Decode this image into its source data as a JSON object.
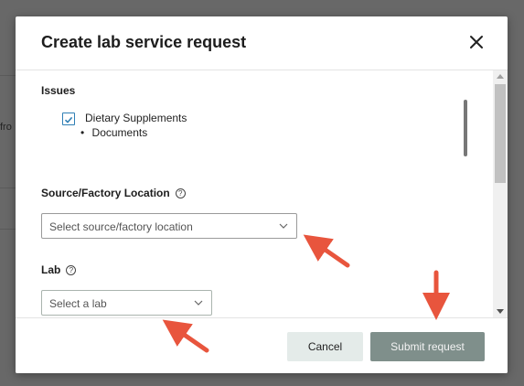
{
  "background": {
    "fragment_text": "fro"
  },
  "modal": {
    "title": "Create lab service request",
    "close_icon": "close-icon"
  },
  "issues": {
    "label": "Issues",
    "items": [
      {
        "label": "Dietary Supplements",
        "checked": true
      },
      {
        "label": "Documents",
        "bullet": true
      }
    ]
  },
  "source": {
    "label": "Source/Factory Location",
    "help_icon": "help-circle-icon",
    "placeholder": "Select source/factory location"
  },
  "lab": {
    "label": "Lab",
    "help_icon": "help-circle-icon",
    "placeholder": "Select a lab"
  },
  "footer": {
    "cancel_label": "Cancel",
    "submit_label": "Submit request"
  },
  "colors": {
    "accent": "#2f7fb5",
    "annotation_arrow": "#e8553d",
    "submit_button": "#7f8f8b",
    "cancel_button": "#e4ebe9"
  }
}
